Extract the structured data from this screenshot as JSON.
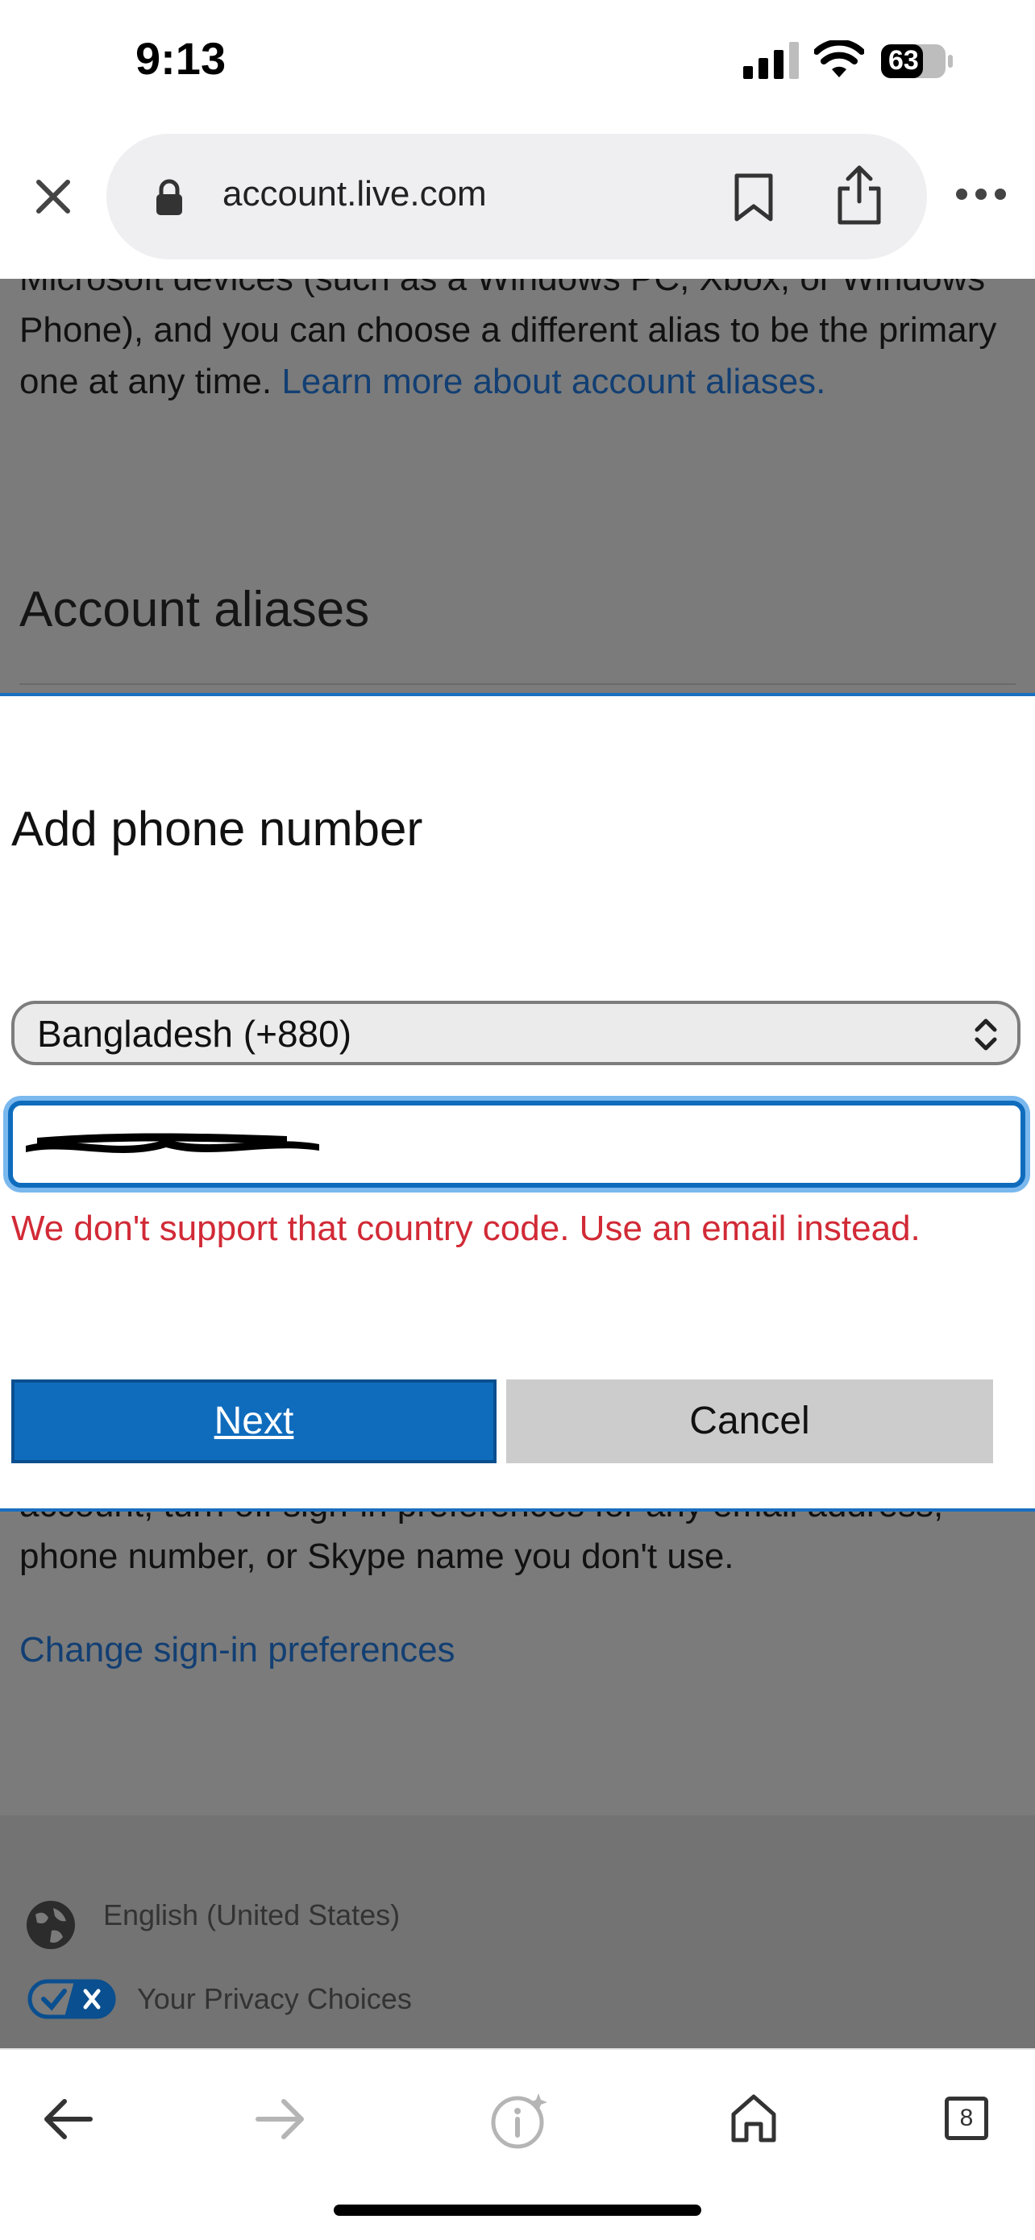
{
  "status_bar": {
    "time": "9:13",
    "battery": "63"
  },
  "browser": {
    "url": "account.live.com"
  },
  "page": {
    "intro_text": "Microsoft devices (such as a Windows PC, Xbox, or Windows Phone), and you can choose a different alias to be the primary one at any time.",
    "intro_link": "Learn more about account aliases.",
    "aliases_title": "Account aliases",
    "lower_text": "account, turn off sign-in preferences for any email address, phone number, or Skype name you don't use.",
    "change_link": "Change sign-in preferences",
    "footer": {
      "language": "English (United States)",
      "privacy": "Your Privacy Choices"
    }
  },
  "modal": {
    "title": "Add phone number",
    "country_selected": "Bangladesh (+880)",
    "error": "We don't support that country code. Use an email instead.",
    "next_label": "Next",
    "cancel_label": "Cancel"
  },
  "bottom_nav": {
    "tabs_count": "8"
  },
  "colors": {
    "accent": "#0f6cbd",
    "error": "#d12a36",
    "link": "#123f73"
  }
}
